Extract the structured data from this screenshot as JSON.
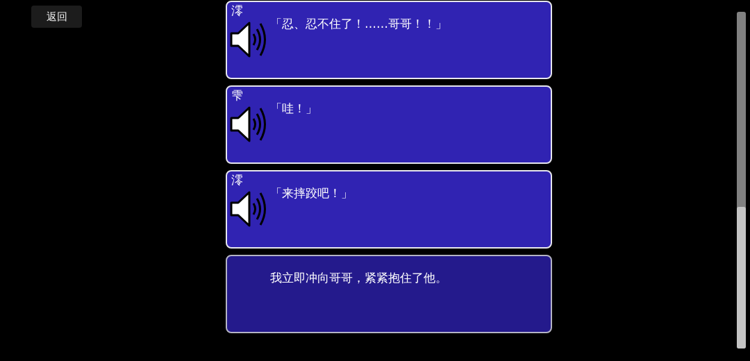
{
  "back_button": {
    "label": "返回"
  },
  "messages": [
    {
      "kind": "voice",
      "speaker": "澪",
      "text": "「忍、忍不住了！……哥哥！！」"
    },
    {
      "kind": "voice",
      "speaker": "雫",
      "text": "「哇！」"
    },
    {
      "kind": "voice",
      "speaker": "澪",
      "text": "「来摔跤吧！」"
    },
    {
      "kind": "narration",
      "text": "我立即冲向哥哥，紧紧抱住了他。"
    }
  ]
}
